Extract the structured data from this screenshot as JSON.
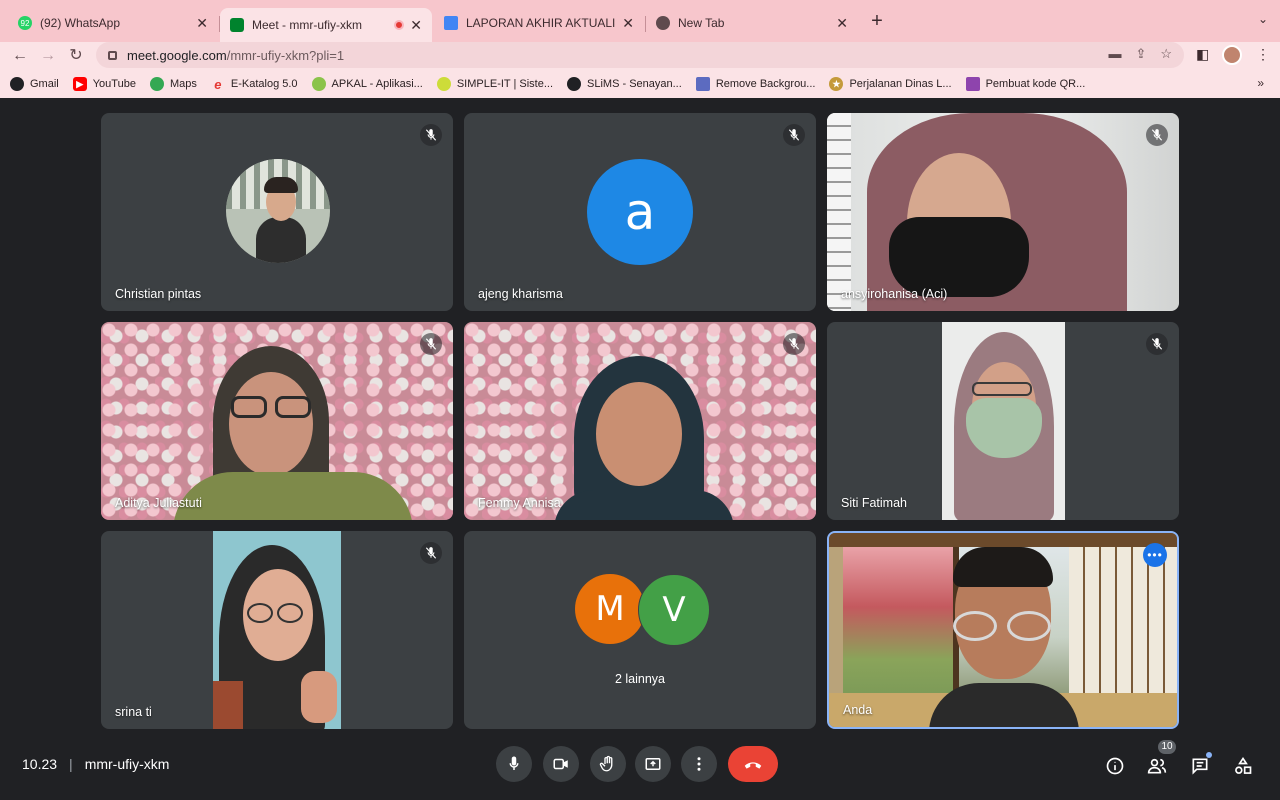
{
  "browser": {
    "tabs": [
      {
        "label": "(92) WhatsApp",
        "icon": "whatsapp-icon",
        "badge": "92"
      },
      {
        "label": "Meet - mmr-ufiy-xkm",
        "icon": "meet-icon"
      },
      {
        "label": "LAPORAN AKHIR AKTUALISASI",
        "icon": "docs-icon"
      },
      {
        "label": "New Tab",
        "icon": "chrome-icon"
      }
    ],
    "url": {
      "host": "meet.google.com",
      "path": "/mmr-ufiy-xkm?pli=1"
    },
    "bookmarks": [
      {
        "label": "Gmail",
        "color": "#202124"
      },
      {
        "label": "YouTube",
        "color": "#ff0000"
      },
      {
        "label": "Maps",
        "color": "#34a853"
      },
      {
        "label": "E-Katalog 5.0",
        "color": "#e53935"
      },
      {
        "label": "APKAL - Aplikasi...",
        "color": "#8bc34a"
      },
      {
        "label": "SIMPLE-IT | Siste...",
        "color": "#cddc39"
      },
      {
        "label": "SLiMS - Senayan...",
        "color": "#202124"
      },
      {
        "label": "Remove Backgrou...",
        "color": "#5c6bc0"
      },
      {
        "label": "Perjalanan Dinas L...",
        "color": "#c49a3a"
      },
      {
        "label": "Pembuat kode QR...",
        "color": "#8e44ad"
      }
    ]
  },
  "participants": [
    {
      "name": "Christian pintas"
    },
    {
      "name": "ajeng kharisma",
      "initial": "a"
    },
    {
      "name": "ansyirohanisa (Aci)"
    },
    {
      "name": "Aditya Juliastuti"
    },
    {
      "name": "Femmy Annisa"
    },
    {
      "name": "Siti Fatimah"
    },
    {
      "name": "srina ti"
    },
    {
      "name": "2 lainnya",
      "initials": [
        "M",
        "V"
      ]
    },
    {
      "name": "Anda"
    }
  ],
  "meeting": {
    "time": "10.23",
    "code": "mmr-ufiy-xkm",
    "people_count": "10"
  },
  "colors": {
    "avatar_a": "#1e88e5",
    "avatar_m": "#e8710a",
    "avatar_v": "#43a047",
    "end_call": "#ea4335",
    "accent": "#8ab4f8"
  }
}
